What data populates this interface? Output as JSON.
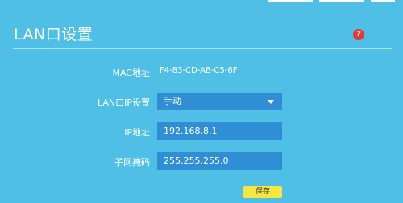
{
  "page": {
    "title": "LAN口设置",
    "help_symbol": "?"
  },
  "form": {
    "mac": {
      "label": "MAC地址",
      "value": "F4-83-CD-AB-C5-6F"
    },
    "lan_ip_setting": {
      "label": "LAN口IP设置",
      "value": "手动"
    },
    "ip_address": {
      "label": "IP地址",
      "value": "192.168.8.1"
    },
    "subnet_mask": {
      "label": "子网掩码",
      "value": "255.255.255.0"
    }
  },
  "actions": {
    "save_label": "保存"
  },
  "colors": {
    "background": "#4fbfe6",
    "field": "#2f8ed4",
    "save_button": "#f5e642",
    "help_icon": "#e53935"
  },
  "icons": {
    "help": "help-icon",
    "dropdown": "chevron-down-icon"
  }
}
